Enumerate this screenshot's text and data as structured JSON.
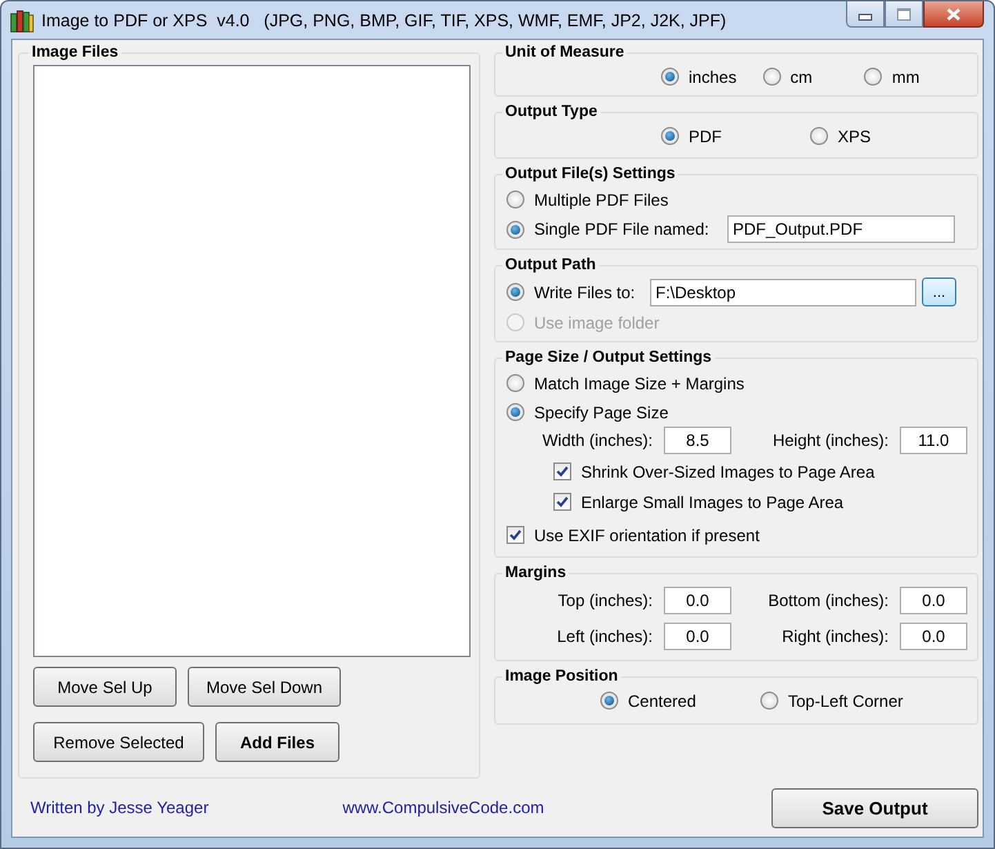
{
  "window": {
    "title": "Image to PDF or XPS  v4.0   (JPG, PNG, BMP, GIF, TIF, XPS, WMF, EMF, JP2, J2K, JPF)"
  },
  "image_files": {
    "title": "Image Files",
    "buttons": [
      {
        "label": "Move Sel Up",
        "bold": false
      },
      {
        "label": "Move Sel Down",
        "bold": false
      },
      {
        "label": "Remove Selected",
        "bold": false
      },
      {
        "label": "Add Files",
        "bold": true
      }
    ]
  },
  "unit_of_measure": {
    "title": "Unit of Measure",
    "options": [
      {
        "label": "inches",
        "selected": true
      },
      {
        "label": "cm",
        "selected": false
      },
      {
        "label": "mm",
        "selected": false
      }
    ]
  },
  "output_type": {
    "title": "Output Type",
    "options": [
      {
        "label": "PDF",
        "selected": true
      },
      {
        "label": "XPS",
        "selected": false
      }
    ]
  },
  "output_file_settings": {
    "title": "Output File(s) Settings",
    "options": [
      {
        "label": "Multiple PDF Files",
        "selected": false
      },
      {
        "label": "Single PDF File named:",
        "selected": true,
        "value": "PDF_Output.PDF"
      }
    ]
  },
  "output_path": {
    "title": "Output Path",
    "options": [
      {
        "label": "Write Files to:",
        "selected": true,
        "disabled": false,
        "value": "F:\\Desktop"
      },
      {
        "label": "Use image folder",
        "selected": false,
        "disabled": true
      }
    ],
    "browse_button": "..."
  },
  "page_size": {
    "title": "Page Size / Output Settings",
    "options": [
      {
        "label": "Match Image Size + Margins",
        "selected": false
      },
      {
        "label": "Specify Page Size",
        "selected": true
      }
    ],
    "fields": [
      {
        "label": "Width (inches):",
        "value": "8.5"
      },
      {
        "label": "Height (inches):",
        "value": "11.0"
      }
    ],
    "checkboxes": [
      {
        "label": "Shrink Over-Sized Images to Page Area",
        "checked": true
      },
      {
        "label": "Enlarge Small Images to Page Area",
        "checked": true
      }
    ],
    "exif": {
      "label": "Use EXIF orientation if present",
      "checked": true
    }
  },
  "margins": {
    "title": "Margins",
    "fields": [
      {
        "label": "Top (inches):",
        "value": "0.0"
      },
      {
        "label": "Bottom (inches):",
        "value": "0.0"
      },
      {
        "label": "Left (inches):",
        "value": "0.0"
      },
      {
        "label": "Right (inches):",
        "value": "0.0"
      }
    ]
  },
  "image_position": {
    "title": "Image Position",
    "options": [
      {
        "label": "Centered",
        "selected": true
      },
      {
        "label": "Top-Left Corner",
        "selected": false
      }
    ]
  },
  "footer": {
    "author": "Written by Jesse Yeager",
    "website": "www.CompulsiveCode.com",
    "save_button": "Save Output"
  }
}
